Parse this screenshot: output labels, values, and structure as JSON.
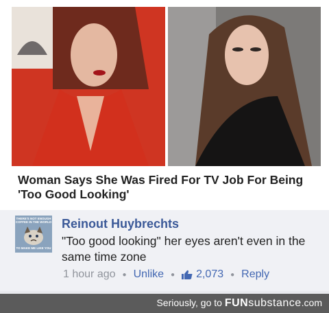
{
  "post": {
    "headline": "Woman Says She Was Fired For TV Job For Being 'Too Good Looking'"
  },
  "comment": {
    "author": "Reinout Huybrechts",
    "text": "\"Too good looking\" her eyes aren't even in the same time zone",
    "time": "1 hour ago",
    "unlike_label": "Unlike",
    "like_count": "2,073",
    "reply_label": "Reply",
    "avatar_caption_top": "THERE'S NOT ENOUGH COFFEE IN THE WORLD",
    "avatar_caption_bottom": "TO MAKE ME LIKE YOU"
  },
  "footer": {
    "prefix": "Seriously, go to",
    "brand_bold": "FUN",
    "brand_rest": "substance",
    "brand_tld": ".com"
  },
  "colors": {
    "link_blue": "#3b5998",
    "footer_bg": "#5b5b5b"
  }
}
